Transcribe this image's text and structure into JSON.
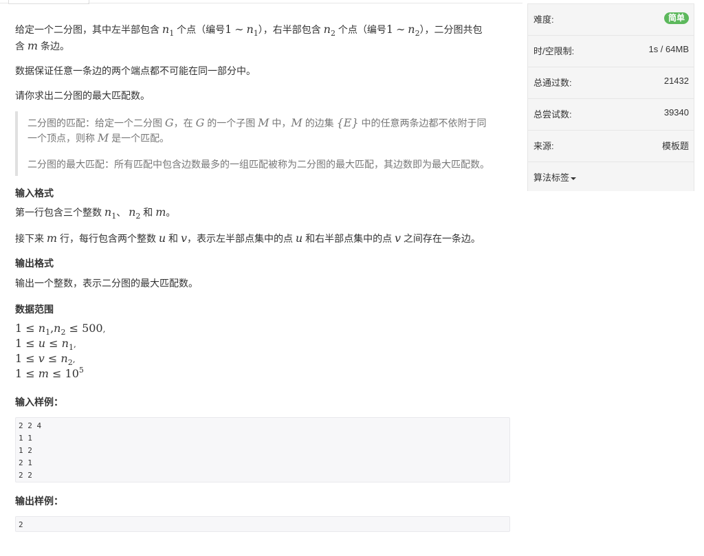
{
  "problem": {
    "intro": {
      "a": "给定一个二分图，其中左半部包含",
      "n1_var": "n",
      "n1_sub": "1",
      "b": "个点（编号",
      "one_a": "1",
      "tilde_a": "∼",
      "n1b_var": "n",
      "n1b_sub": "1",
      "c": "），右半部包含",
      "n2_var": "n",
      "n2_sub": "2",
      "d": "个点（编号",
      "one_b": "1",
      "tilde_b": "∼",
      "n2b_var": "n",
      "n2b_sub": "2",
      "e": "），二分图共包",
      "f": "含",
      "m_var": "m",
      "g": "条边。"
    },
    "guarantee": "数据保证任意一条边的两个端点都不可能在同一部分中。",
    "ask": "请你求出二分图的最大匹配数。",
    "quote": {
      "def1_a": "二分图的匹配：给定一个二分图",
      "G1": "G",
      "def1_b": "，在",
      "G2": "G",
      "def1_c": "的一个子图",
      "M1": "M",
      "def1_d": "中，",
      "M2": "M",
      "def1_e": "的边集",
      "E_set": "{E}",
      "def1_f": "中的任意两条边都不依附于同",
      "def1_g": "一个顶点，则称",
      "M3": "M",
      "def1_h": "是一个匹配。",
      "def2": "二分图的最大匹配：所有匹配中包含边数最多的一组匹配被称为二分图的最大匹配，其边数即为最大匹配数。"
    },
    "input_format": {
      "title": "输入格式",
      "l1_a": "第一行包含三个整数",
      "l1_n": "n",
      "l1_n1": "1",
      "l1_sep": "、",
      "l1_n2v": "n",
      "l1_n2": "2",
      "l1_and": "和",
      "l1_m": "m",
      "l1_end": "。",
      "l2_a": "接下来",
      "l2_m": "m",
      "l2_b": "行，每行包含两个整数",
      "l2_u": "u",
      "l2_and": "和",
      "l2_v": "v",
      "l2_c": "，表示左半部点集中的点",
      "l2_u2": "u",
      "l2_d": "和右半部点集中的点",
      "l2_v2": "v",
      "l2_e": "之间存在一条边。"
    },
    "output_format": {
      "title": "输出格式",
      "text": "输出一个整数，表示二分图的最大匹配数。"
    },
    "range": {
      "title": "数据范围",
      "r1_a": "1 ≤ ",
      "r1_n": "n",
      "r1_s1": "1",
      "r1_comma": ",",
      "r1_n2": "n",
      "r1_s2": "2",
      "r1_b": " ≤ 500",
      "r1_p": ",",
      "r2_a": "1 ≤ ",
      "r2_u": "u",
      "r2_b": " ≤ ",
      "r2_n": "n",
      "r2_s": "1",
      "r2_p": ",",
      "r3_a": "1 ≤ ",
      "r3_v": "v",
      "r3_b": " ≤ ",
      "r3_n": "n",
      "r3_s": "2",
      "r3_p": ",",
      "r4_a": "1 ≤ ",
      "r4_m": "m",
      "r4_b": " ≤ 10",
      "r4_exp": "5"
    },
    "sample_input": {
      "title": "输入样例：",
      "lines": [
        "2 2 4",
        "1 1",
        "1 2",
        "2 1",
        "2 2"
      ]
    },
    "sample_output": {
      "title": "输出样例：",
      "text": "2"
    }
  },
  "sidebar": {
    "difficulty_label": "难度:",
    "difficulty_value": "简单",
    "limits_label": "时/空限制:",
    "limits_value": "1s / 64MB",
    "passed_label": "总通过数:",
    "passed_value": "21432",
    "attempts_label": "总尝试数:",
    "attempts_value": "39340",
    "source_label": "来源:",
    "source_value": "模板题",
    "tags_label": "算法标签"
  },
  "colors": {
    "badge_green": "#5cb85c",
    "quote_border": "#e0e0e0",
    "sidebar_bg": "#f5f5f5"
  }
}
